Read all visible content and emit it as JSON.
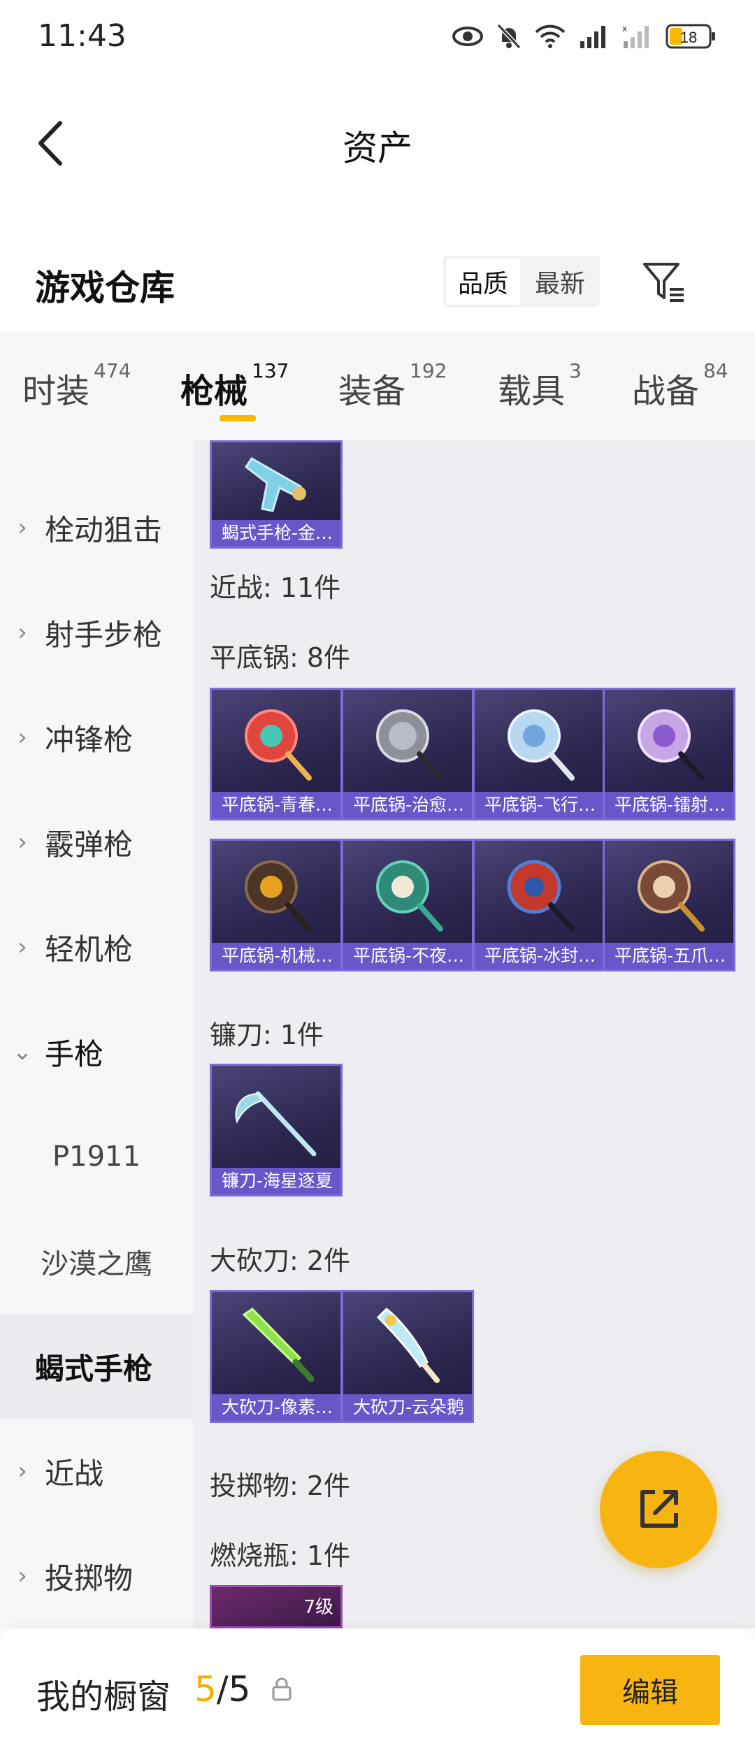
{
  "status": {
    "time": "11:43",
    "battery": "18"
  },
  "header": {
    "title": "资产"
  },
  "warehouse": {
    "title": "游戏仓库",
    "sort_quality": "品质",
    "sort_newest": "最新"
  },
  "tabs": [
    {
      "label": "时装",
      "count": "474"
    },
    {
      "label": "枪械",
      "count": "137"
    },
    {
      "label": "装备",
      "count": "192"
    },
    {
      "label": "载具",
      "count": "3"
    },
    {
      "label": "战备",
      "count": "84"
    }
  ],
  "sidebar": {
    "items": [
      "栓动狙击",
      "射手步枪",
      "冲锋枪",
      "霰弹枪",
      "轻机枪",
      "手枪"
    ],
    "sub_items": [
      "P1911",
      "沙漠之鹰",
      "蝎式手枪"
    ],
    "bottom_items": [
      "近战",
      "投掷物"
    ]
  },
  "content": {
    "top_card": "蝎式手枪-金…",
    "melee_header": "近战: 11件",
    "pan_header": "平底锅: 8件",
    "pans": [
      "平底锅-青春…",
      "平底锅-治愈…",
      "平底锅-飞行…",
      "平底锅-镭射…",
      "平底锅-机械…",
      "平底锅-不夜…",
      "平底锅-冰封…",
      "平底锅-五爪…"
    ],
    "sickle_header": "镰刀: 1件",
    "sickle": "镰刀-海星逐夏",
    "machete_header": "大砍刀: 2件",
    "machetes": [
      "大砍刀-像素…",
      "大砍刀-云朵鹅"
    ],
    "throw_header": "投掷物: 2件",
    "molotov_header": "燃烧瓶: 1件",
    "molotov_level": "7级"
  },
  "bottom": {
    "label": "我的橱窗",
    "current": "5",
    "sep_total": "/5",
    "edit": "编辑"
  },
  "colors": {
    "accent": "#f8b512",
    "card_border": "#7f6ad8",
    "card_label": "#6757c8"
  }
}
